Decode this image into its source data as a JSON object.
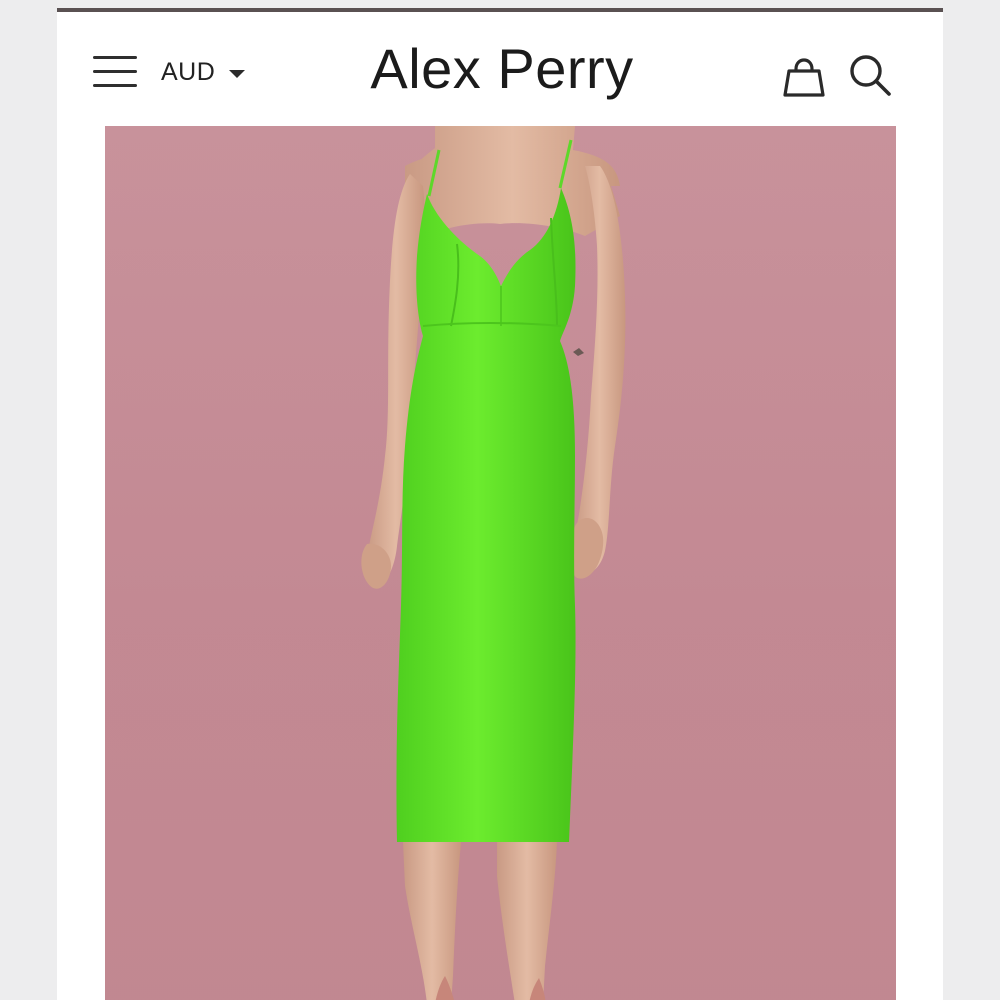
{
  "header": {
    "currency": "AUD",
    "brand": "Alex Perry"
  },
  "icons": {
    "menu": "hamburger-menu-icon",
    "currency_caret": "chevron-down-icon",
    "bag": "shopping-bag-icon",
    "search": "search-icon"
  },
  "colors": {
    "background_pink": "#c48a94",
    "dress_green": "#66e62a",
    "header_text": "#1b1b1b"
  }
}
